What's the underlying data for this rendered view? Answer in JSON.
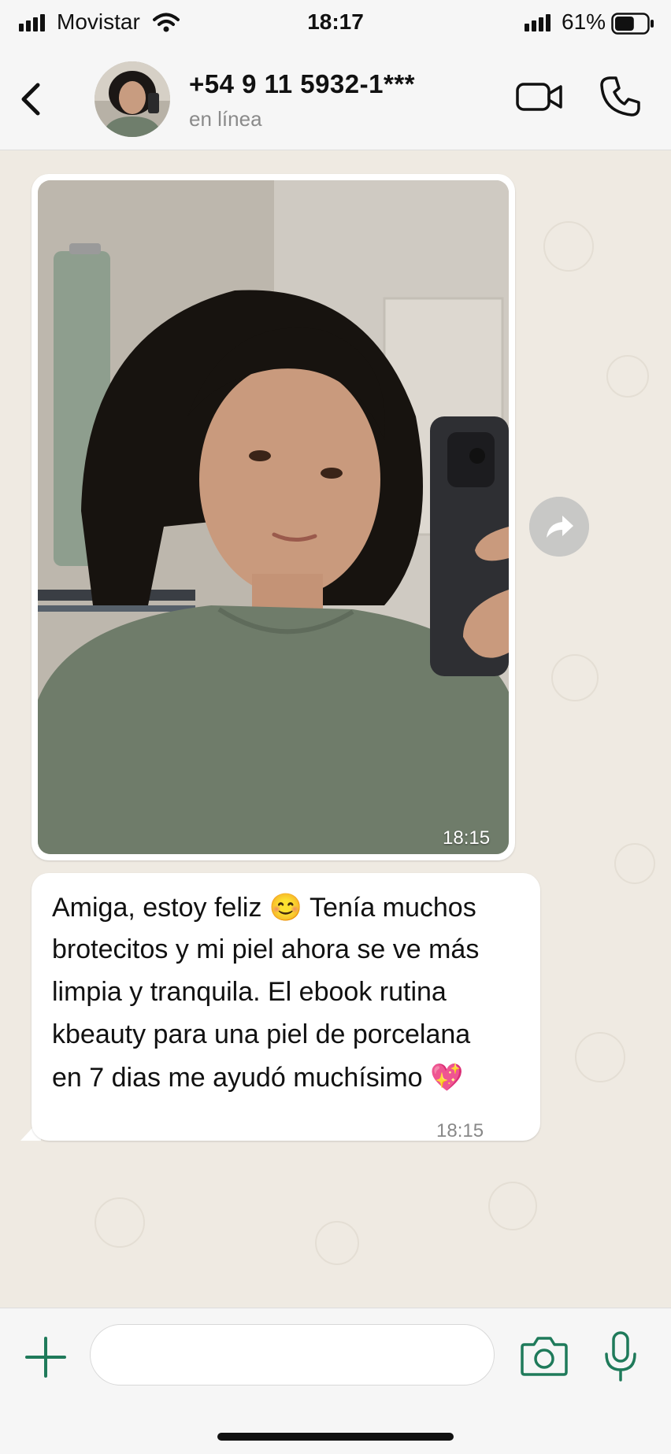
{
  "status_bar": {
    "carrier": "Movistar",
    "time": "18:17",
    "battery_percent": "61%",
    "battery_level": 0.61
  },
  "header": {
    "contact_name": "+54 9 11 5932-1***",
    "contact_status": "en línea",
    "icons": [
      "back-chevron-icon",
      "video-call-icon",
      "phone-call-icon"
    ]
  },
  "messages": [
    {
      "type": "image",
      "time": "18:15"
    },
    {
      "type": "text",
      "lines": [
        "Amiga, estoy feliz 😊 Tenía muchos",
        "brotecitos y mi piel ahora se ve más",
        "limpia y tranquila. El ebook rutina",
        "kbeauty para una piel de porcelana",
        "en 7 dias me ayudó muchísimo 💖"
      ],
      "time": "18:15"
    }
  ],
  "composer": {
    "input_value": "",
    "icons": [
      "plus-icon",
      "camera-icon",
      "microphone-icon"
    ]
  },
  "colors": {
    "accent": "#1f7a5a",
    "chat_background": "#efeae2",
    "bubble": "#ffffff"
  }
}
